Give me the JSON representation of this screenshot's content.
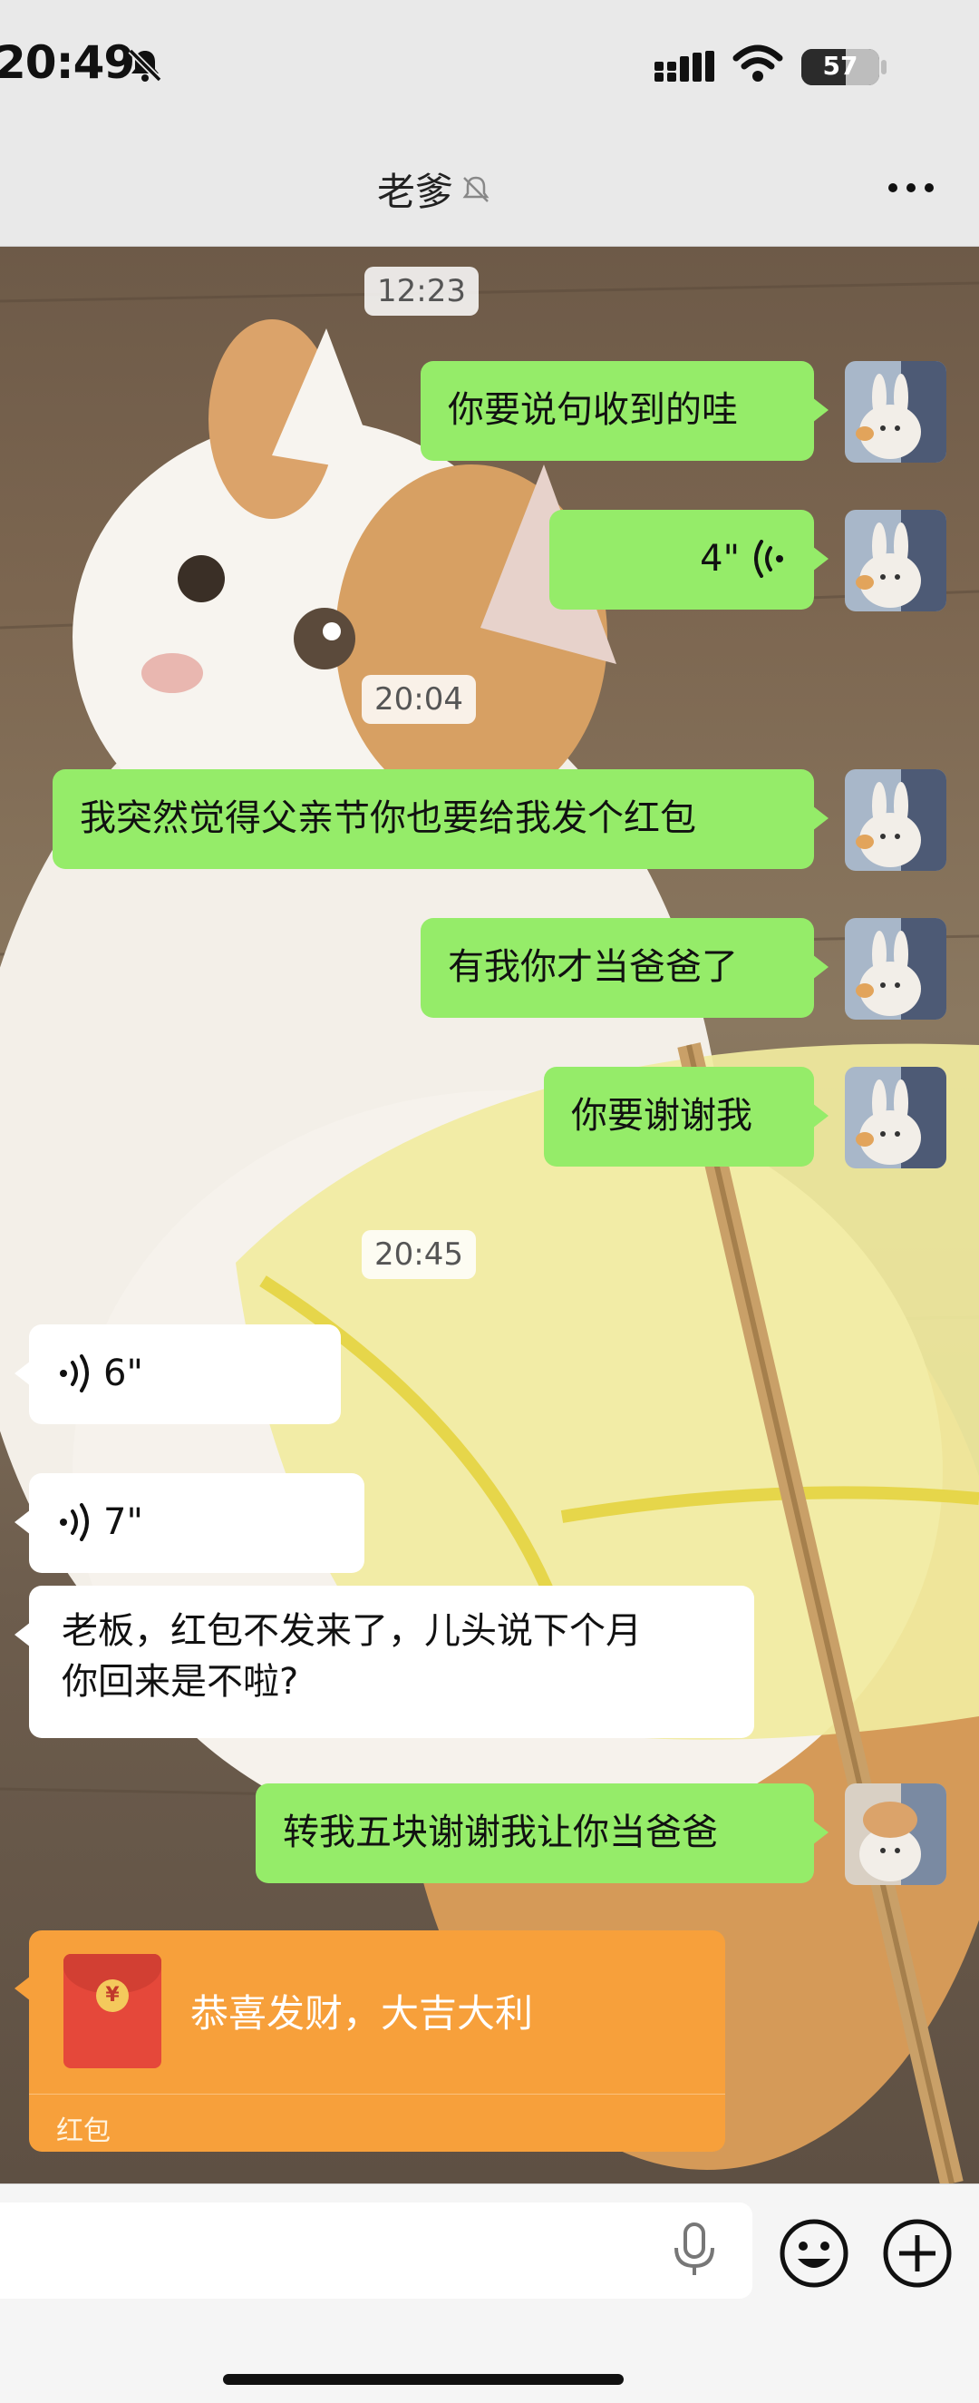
{
  "status_bar": {
    "time": "20:49",
    "battery": "57",
    "battery_level": 0.57
  },
  "header": {
    "title": "老爹"
  },
  "timestamps": [
    "12:23",
    "20:04",
    "20:45"
  ],
  "messages": {
    "m1": "你要说句收到的哇",
    "m2": "4\"",
    "m3": "我突然觉得父亲节你也要给我发个红包",
    "m4": "有我你才当爸爸了",
    "m5": "你要谢谢我",
    "m6": "6\"",
    "m7": "7\"",
    "m8_line1": "老板，红包不发来了，儿头说下个月",
    "m8_line2": "你回来是不啦?",
    "m9": "转我五块谢谢我让你当爸爸"
  },
  "red_packet": {
    "greeting": "恭喜发财，大吉大利",
    "label": "红包",
    "coin": "¥"
  },
  "colors": {
    "sent_bubble": "#95ec69",
    "received_bubble": "#ffffff",
    "red_packet": "#f7a03b"
  }
}
